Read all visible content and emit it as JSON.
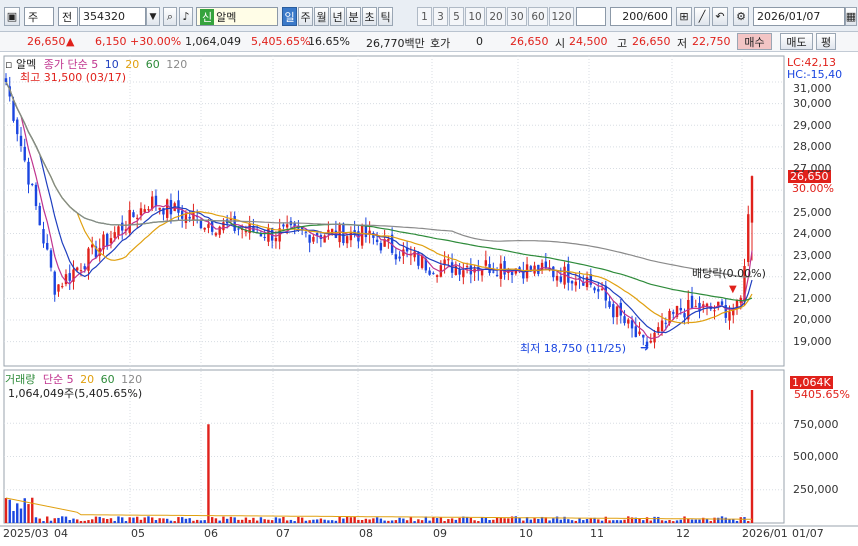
{
  "toolbar": {
    "market": "주",
    "type": "전",
    "code": "354320",
    "badge": "신",
    "name": "알멕",
    "periods": [
      "일",
      "주",
      "월",
      "년",
      "분",
      "초",
      "틱"
    ],
    "selected_period": "일",
    "minutes": [
      "1",
      "3",
      "5",
      "10",
      "20",
      "30",
      "60",
      "120"
    ],
    "count": "200/600",
    "date": "2026/01/07"
  },
  "quote": {
    "price": "26,650",
    "change": "6,150",
    "change_pct": "+30.00%",
    "volume": "1,064,049",
    "vol_ratio": "5,405.65%",
    "turnover": "16.65%",
    "amount": "26,770백만",
    "hoga_label": "호가",
    "hoga_value": "0",
    "hoga_price": "26,650",
    "open_label": "시",
    "open": "24,500",
    "high_label": "고",
    "high": "26,650",
    "low_label": "저",
    "low": "22,750",
    "buy": "매수",
    "sell": "매도",
    "eval": "평"
  },
  "price_panel": {
    "legend_name": "알멕",
    "legend_ma": "종가 단순",
    "ma_periods": [
      "5",
      "10",
      "20",
      "60",
      "120"
    ],
    "high_note": "최고 31,500 (03/17)",
    "low_note": "최저 18,750 (11/25)",
    "dividend_note": "배당락(0.00%)",
    "lc": "LC:42,13",
    "hc": "HC:-15,40",
    "current_price": "26,650",
    "current_pct": "30.00%"
  },
  "volume_panel": {
    "legend_name": "거래량",
    "legend_ma": "단순",
    "ma_periods": [
      "5",
      "20",
      "60",
      "120"
    ],
    "summary": "1,064,049주(5,405.65%)",
    "current": "1,064K",
    "current_pct": "5405.65%"
  },
  "colors": {
    "up": "#e0211b",
    "down": "#1b46e0",
    "ma5": "#c0348f",
    "ma10": "#1f3fbf",
    "ma20": "#e0a010",
    "ma60": "#2e8b3a",
    "ma120": "#8a8a8a"
  },
  "chart_data": [
    {
      "type": "line",
      "title": "알멕 일봉",
      "y_ticks": [
        "31,000",
        "30,000",
        "29,000",
        "28,000",
        "27,000",
        "26,000",
        "25,000",
        "24,000",
        "23,000",
        "22,000",
        "21,000",
        "20,000",
        "19,000"
      ],
      "x_ticks": [
        "2025/03",
        "04",
        "05",
        "06",
        "07",
        "08",
        "09",
        "10",
        "11",
        "12",
        "2026/01",
        "01/07"
      ],
      "ylim": [
        18500,
        31500
      ],
      "series": [
        {
          "name": "종가",
          "x": [
            "2025/03",
            "04",
            "05",
            "06",
            "07",
            "08",
            "09",
            "10",
            "11",
            "11/25",
            "12",
            "2026/01",
            "01/07"
          ],
          "values": [
            31000,
            21500,
            25500,
            24500,
            24000,
            24000,
            22500,
            22500,
            22000,
            18750,
            20500,
            20500,
            26650
          ]
        }
      ]
    },
    {
      "type": "bar",
      "title": "거래량",
      "y_ticks": [
        "750,000",
        "500,000",
        "250,000"
      ],
      "ylim": [
        0,
        1064049
      ],
      "series": [
        {
          "name": "거래량",
          "x": [
            "2025/03",
            "06",
            "2026/01/07"
          ],
          "values": [
            220000,
            790000,
            1064049
          ]
        }
      ]
    }
  ]
}
